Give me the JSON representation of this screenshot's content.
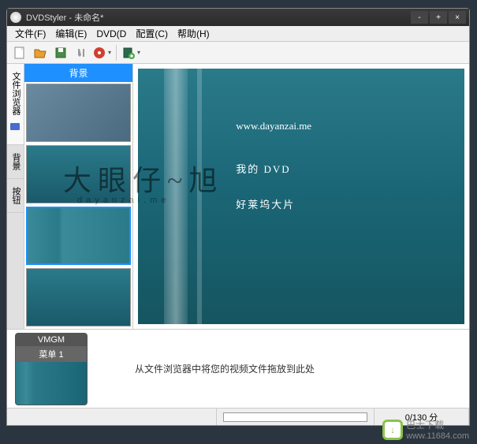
{
  "titlebar": {
    "app": "DVDStyler",
    "doc": "未命名*"
  },
  "menus": {
    "file": "文件(F)",
    "edit": "编辑(E)",
    "dvd": "DVD(D",
    "config": "配置(C)",
    "help": "帮助(H)"
  },
  "side_tabs": {
    "browser": "文件浏览器",
    "background": "背景",
    "button": "按钮"
  },
  "browser": {
    "header": "背景"
  },
  "preview": {
    "line1": "www.dayanzai.me",
    "line2": "我的 DVD",
    "line3": "好莱坞大片"
  },
  "vmgm": {
    "head": "VMGM",
    "label": "菜单 1"
  },
  "drop_hint": "从文件浏览器中将您的视频文件拖放到此处",
  "status": {
    "time": "0/130 分"
  },
  "watermark": {
    "main": "大眼仔~旭",
    "sub": "dayanzai.me"
  },
  "footer": {
    "site_name": "巴士下载",
    "site_url": "www.11684.com"
  }
}
